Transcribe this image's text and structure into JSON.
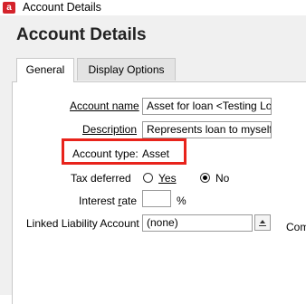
{
  "window": {
    "title": "Account Details",
    "app_icon_letter": "a",
    "brand_color": "#d4232b"
  },
  "page": {
    "heading": "Account Details"
  },
  "tabs": [
    {
      "label": "General",
      "active": true
    },
    {
      "label": "Display Options",
      "active": false
    }
  ],
  "form": {
    "account_name": {
      "label": "Account name",
      "value": "Asset for loan <Testing Loa"
    },
    "description": {
      "label": "Description",
      "value": "Represents loan to myself f"
    },
    "account_type": {
      "label": "Account type:",
      "value": "Asset"
    },
    "tax_deferred": {
      "label": "Tax deferred",
      "options": [
        {
          "label": "Yes",
          "selected": false
        },
        {
          "label": "No",
          "selected": true
        }
      ]
    },
    "interest_rate": {
      "label": "Interest rate",
      "value": "",
      "unit": "%"
    },
    "linked_liability": {
      "label": "Linked Liability Account",
      "value": "(none)"
    },
    "truncated_right_label": "Com"
  },
  "highlight_color": "#e8231b"
}
